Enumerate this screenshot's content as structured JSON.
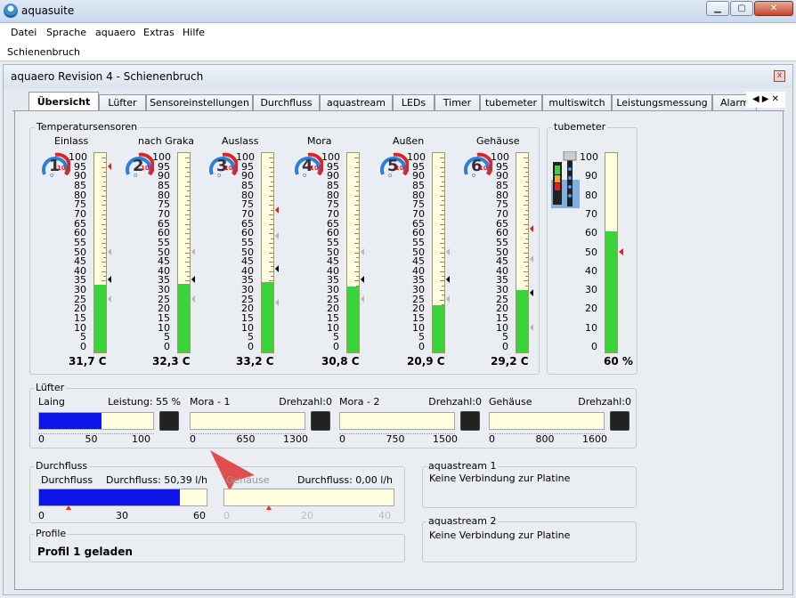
{
  "window": {
    "title": "aquasuite",
    "menu": [
      "Datei",
      "Sprache",
      "aquaero",
      "Extras",
      "Hilfe"
    ],
    "subtitle": "Schienenbruch",
    "panel_title": "aquaero Revision 4 - Schienenbruch",
    "close_glyph": "x"
  },
  "tabs": [
    "Übersicht",
    "Lüfter",
    "Sensoreinstellungen",
    "Durchfluss",
    "aquastream",
    "LEDs",
    "Timer",
    "tubemeter",
    "multiswitch",
    "Leistungsmessung",
    "Alarm"
  ],
  "tab_arrows": "◀ ▶ ✕",
  "temperatures": {
    "title": "Temperatursensoren",
    "scale": [
      "100",
      "95",
      "90",
      "85",
      "80",
      "75",
      "70",
      "65",
      "60",
      "55",
      "50",
      "45",
      "40",
      "35",
      "30",
      "25",
      "20",
      "15",
      "10",
      "5",
      "0"
    ],
    "sensors": [
      {
        "name": "Einlass",
        "number": "1",
        "max": "100",
        "unit": "o",
        "value": 31.7,
        "display": "31,7 C",
        "marker_red": 95,
        "marker_black": 35,
        "marker_gray": [
          50,
          25
        ]
      },
      {
        "name": "nach Graka",
        "number": "2",
        "max": "100",
        "unit": "o",
        "value": 32.3,
        "display": "32,3 C",
        "marker_red": null,
        "marker_black": 35,
        "marker_gray": [
          50,
          25
        ]
      },
      {
        "name": "Auslass",
        "number": "3",
        "max": "100",
        "unit": "o",
        "value": 33.2,
        "display": "33,2 C",
        "marker_red": 72,
        "marker_black": 41,
        "marker_gray": [
          58,
          23
        ]
      },
      {
        "name": "Mora",
        "number": "4",
        "max": "100",
        "unit": "o",
        "value": 30.8,
        "display": "30,8 C",
        "marker_red": null,
        "marker_black": 35,
        "marker_gray": [
          50,
          25
        ]
      },
      {
        "name": "Außen",
        "number": "5",
        "max": "100",
        "unit": "o",
        "value": 20.9,
        "display": "20,9 C",
        "marker_red": null,
        "marker_black": 35,
        "marker_gray": [
          50,
          25
        ]
      },
      {
        "name": "Gehäuse",
        "number": "6",
        "max": "100",
        "unit": "o",
        "value": 29.2,
        "display": "29,2 C",
        "marker_red": 62,
        "marker_black": 28,
        "marker_gray": [
          46,
          10
        ]
      }
    ]
  },
  "tubemeter": {
    "title": "tubemeter",
    "scale": [
      "100",
      "90",
      "80",
      "70",
      "60",
      "50",
      "40",
      "30",
      "20",
      "10",
      "0"
    ],
    "value": 60,
    "display": "60 %",
    "marker_red": 50
  },
  "fans": {
    "title": "Lüfter",
    "items": [
      {
        "name": "Laing",
        "metric": "Leistung: 55 %",
        "fill": 0.55,
        "scale": [
          "0",
          "50",
          "100"
        ]
      },
      {
        "name": "Mora - 1",
        "metric": "Drehzahl:0",
        "fill": 0,
        "scale": [
          "0",
          "650",
          "1300"
        ]
      },
      {
        "name": "Mora - 2",
        "metric": "Drehzahl:0",
        "fill": 0,
        "scale": [
          "0",
          "750",
          "1500"
        ]
      },
      {
        "name": "Gehäuse",
        "metric": "Drehzahl:0",
        "fill": 0,
        "scale": [
          "0",
          "800",
          "1600"
        ]
      }
    ]
  },
  "flow": {
    "title": "Durchfluss",
    "items": [
      {
        "name": "Durchfluss",
        "metric": "Durchfluss: 50,39 l/h",
        "fill": 0.84,
        "scale": [
          "0",
          "30",
          "60"
        ],
        "alarm_mark": 0.18,
        "dim": false
      },
      {
        "name": "Gehäuse",
        "metric": "Durchfluss: 0,00 l/h",
        "fill": 0,
        "scale": [
          "0",
          "20",
          "40"
        ],
        "alarm_mark": 0.27,
        "dim": true
      }
    ]
  },
  "aquastream": [
    {
      "title": "aquastream 1",
      "message": "Keine Verbindung zur Platine"
    },
    {
      "title": "aquastream 2",
      "message": "Keine Verbindung zur Platine"
    }
  ],
  "profile": {
    "title": "Profile",
    "status": "Profil 1 geladen"
  },
  "colors": {
    "fill_green": "#39d33a",
    "fill_blue": "#0c14e8",
    "marker_red": "#e02020",
    "bar_bg": "#fffde0",
    "gauge_red": "#d8262a",
    "gauge_blue": "#2a7fd8"
  }
}
